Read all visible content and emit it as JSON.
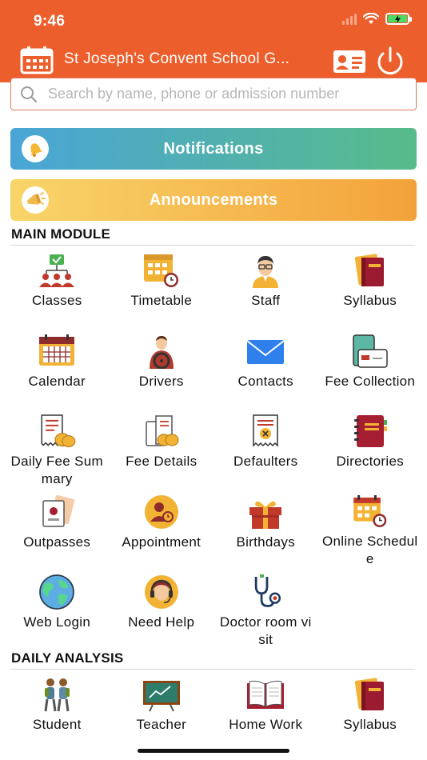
{
  "status": {
    "time": "9:46"
  },
  "header": {
    "title": "St Joseph's Convent School G...",
    "icons": [
      "calendar-icon",
      "id-card-icon",
      "power-icon"
    ],
    "bg_color": "#EC5E2C"
  },
  "search": {
    "placeholder": "Search by name, phone or admission number",
    "value": ""
  },
  "banners": {
    "notifications": {
      "label": "Notifications",
      "icon": "bell-icon"
    },
    "announcements": {
      "label": "Announcements",
      "icon": "megaphone-icon"
    }
  },
  "main_module": {
    "title": "MAIN MODULE",
    "items": [
      {
        "label": "Classes",
        "icon": "classes-icon"
      },
      {
        "label": "Timetable",
        "icon": "timetable-icon"
      },
      {
        "label": "Staff",
        "icon": "staff-icon"
      },
      {
        "label": "Syllabus",
        "icon": "syllabus-icon"
      },
      {
        "label": "Calendar",
        "icon": "calendar-icon"
      },
      {
        "label": "Drivers",
        "icon": "driver-icon"
      },
      {
        "label": "Contacts",
        "icon": "envelope-icon"
      },
      {
        "label": "Fee Collection",
        "icon": "fee-collection-icon"
      },
      {
        "label": "Daily Fee Summary",
        "icon": "receipt-coins-icon"
      },
      {
        "label": "Fee Details",
        "icon": "fee-details-icon"
      },
      {
        "label": "Defaulters",
        "icon": "defaulters-icon"
      },
      {
        "label": "Directories",
        "icon": "directory-book-icon"
      },
      {
        "label": "Outpasses",
        "icon": "outpass-icon"
      },
      {
        "label": "Appointment",
        "icon": "appointment-icon"
      },
      {
        "label": "Birthdays",
        "icon": "gift-icon"
      },
      {
        "label": "Online Schedule",
        "icon": "schedule-icon"
      },
      {
        "label": "Web Login",
        "icon": "globe-icon"
      },
      {
        "label": "Need Help",
        "icon": "support-headset-icon"
      },
      {
        "label": "Doctor room visit",
        "icon": "stethoscope-icon"
      }
    ]
  },
  "daily_analysis": {
    "title": "DAILY ANALYSIS",
    "items": [
      {
        "label": "Student",
        "icon": "students-icon"
      },
      {
        "label": "Teacher",
        "icon": "teacher-board-icon"
      },
      {
        "label": "Home Work",
        "icon": "open-book-icon"
      },
      {
        "label": "Syllabus",
        "icon": "syllabus-icon"
      }
    ]
  }
}
